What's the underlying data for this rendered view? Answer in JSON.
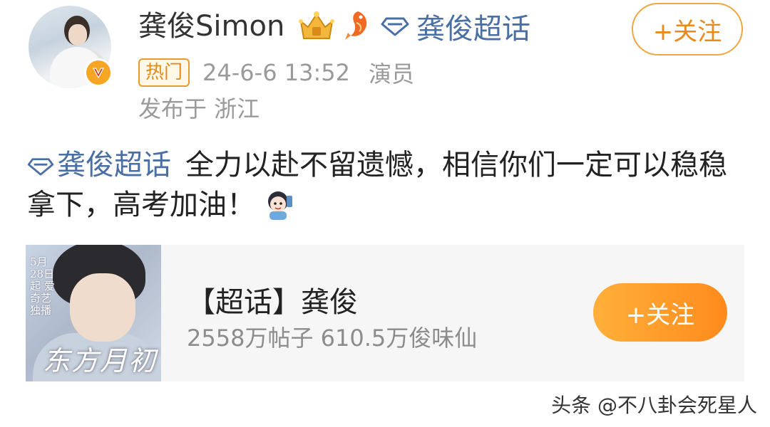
{
  "post": {
    "user": {
      "name": "龚俊Simon",
      "crown_icon": "crown-icon",
      "koi_icon": "koi-fish-icon",
      "verified_icon": "verified-v-icon",
      "topic": "龚俊超话",
      "follow_label": "+关注"
    },
    "meta": {
      "tag": "热门",
      "time": "24-6-6 13:52",
      "role": "演员",
      "location": "发布于 浙江"
    },
    "content": {
      "topic": "龚俊超话",
      "text": "全力以赴不留遗憾，相信你们一定可以稳稳拿下，高考加油！"
    }
  },
  "card": {
    "thumb_side_text": "5月28日起 爱奇艺独播",
    "thumb_title": "东方月初",
    "title": "【超话】龚俊",
    "stats": "2558万帖子 610.5万俊味仙",
    "follow_label": "+关注"
  },
  "watermark": "头条 @不八卦会死星人",
  "colors": {
    "link": "#4a6fa5",
    "accent": "#ff8a1c",
    "meta_gray": "#9a9a9a"
  }
}
